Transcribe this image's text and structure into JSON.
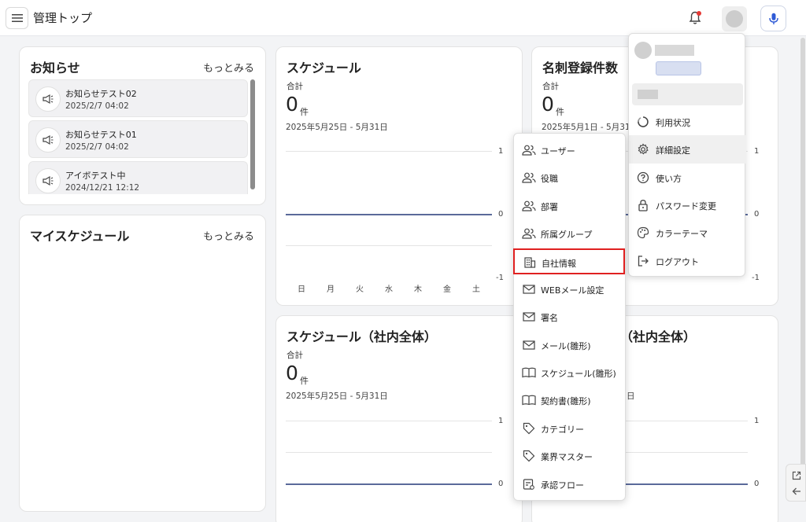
{
  "header": {
    "title": "管理トップ",
    "icons": {
      "menu": "hamburger-icon",
      "notifications": "bell-icon",
      "account": "avatar",
      "voice": "mic-icon"
    },
    "colors": {
      "notification_dot": "#e53935",
      "mic": "#2f5bd6"
    }
  },
  "news": {
    "title": "お知らせ",
    "more": "もっとみる",
    "items": [
      {
        "title": "お知らせテスト02",
        "date": "2025/2/7 04:02"
      },
      {
        "title": "お知らせテスト01",
        "date": "2025/2/7 04:02"
      },
      {
        "title": "アイボテスト中",
        "date": "2024/12/21 12:12"
      }
    ]
  },
  "my_schedule": {
    "title": "マイスケジュール",
    "more": "もっとみる"
  },
  "schedule": {
    "title": "スケジュール",
    "sum_label": "合計",
    "value": "0",
    "unit": "件",
    "date_range": "2025年5月25日 - 5月31日",
    "y_ticks": [
      "1",
      "0",
      "-1"
    ],
    "days": [
      "日",
      "月",
      "火",
      "水",
      "木",
      "金",
      "土"
    ]
  },
  "cards_registered": {
    "title": "名刺登録件数",
    "sum_label": "合計",
    "value": "0",
    "unit": "件",
    "date_range": "2025年5月1日 - 5月31日",
    "y_ticks": [
      "1",
      "0",
      "-1"
    ]
  },
  "schedule_company": {
    "title": "スケジュール（社内全体）",
    "sum_label": "合計",
    "value": "0",
    "unit": "件",
    "date_range": "2025年5月25日 - 5月31日",
    "y_ticks": [
      "1",
      "0"
    ]
  },
  "schedule_company2": {
    "title_partial": "（社内全体）",
    "date_partial": "日",
    "y_ticks": [
      "1",
      "0"
    ]
  },
  "account_menu": {
    "items": [
      {
        "label": "利用状況",
        "icon": "usage-icon"
      },
      {
        "label": "詳細設定",
        "icon": "gear-icon"
      },
      {
        "label": "使い方",
        "icon": "help-icon"
      },
      {
        "label": "パスワード変更",
        "icon": "lock-icon"
      },
      {
        "label": "カラーテーマ",
        "icon": "palette-icon"
      },
      {
        "label": "ログアウト",
        "icon": "logout-icon"
      }
    ]
  },
  "settings_menu": {
    "items": [
      {
        "label": "ユーザー",
        "icon": "users-icon"
      },
      {
        "label": "役職",
        "icon": "users-icon"
      },
      {
        "label": "部署",
        "icon": "users-icon"
      },
      {
        "label": "所属グループ",
        "icon": "users-icon"
      },
      {
        "label": "自社情報",
        "icon": "building-icon"
      },
      {
        "label": "WEBメール設定",
        "icon": "mail-icon"
      },
      {
        "label": "署名",
        "icon": "mail-icon"
      },
      {
        "label": "メール(雛形)",
        "icon": "mail-icon"
      },
      {
        "label": "スケジュール(雛形)",
        "icon": "book-icon"
      },
      {
        "label": "契約書(雛形)",
        "icon": "book-icon"
      },
      {
        "label": "カテゴリー",
        "icon": "tag-icon"
      },
      {
        "label": "業界マスター",
        "icon": "tag-icon"
      },
      {
        "label": "承認フロー",
        "icon": "flow-icon"
      }
    ]
  },
  "side_tools": {
    "open": "external-link-icon",
    "back": "arrow-left-icon"
  }
}
